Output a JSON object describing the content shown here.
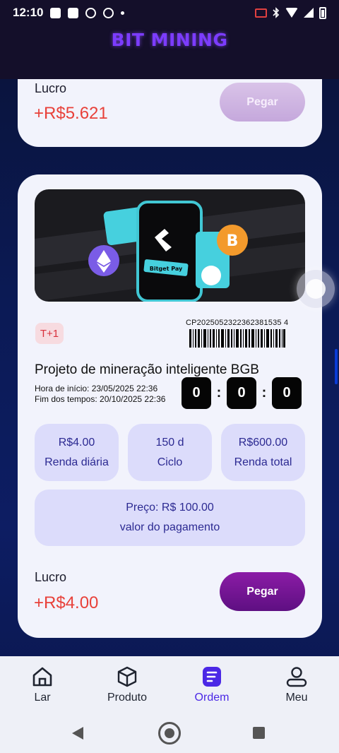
{
  "status_bar": {
    "time": "12:10"
  },
  "header": {
    "brand": "BIT MINING"
  },
  "previous_card": {
    "lucro_label": "Lucro",
    "lucro_value": "+R$5.621",
    "button_label": "Pegar"
  },
  "order": {
    "banner_text": "Bitget Pay",
    "tag": "T+1",
    "code": "CP2025052322362381535 4",
    "title": "Projeto de mineração inteligente BGB",
    "start_time": "Hora de início: 23/05/2025 22:36",
    "end_time": "Fim dos tempos: 20/10/2025 22:36",
    "timer": [
      "0",
      "0",
      "0"
    ],
    "timer_sep": ":",
    "stats": [
      {
        "value": "R$4.00",
        "label": "Renda diária"
      },
      {
        "value": "150 d",
        "label": "Ciclo"
      },
      {
        "value": "R$600.00",
        "label": "Renda total"
      }
    ],
    "price_line": "Preço: R$ 100.00",
    "payment_label": "valor do pagamento",
    "lucro_label": "Lucro",
    "lucro_value": "+R$4.00",
    "button_label": "Pegar"
  },
  "nav": {
    "items": [
      {
        "label": "Lar",
        "icon": "home-icon",
        "active": false
      },
      {
        "label": "Produto",
        "icon": "box-icon",
        "active": false
      },
      {
        "label": "Ordem",
        "icon": "order-icon",
        "active": true
      },
      {
        "label": "Meu",
        "icon": "user-icon",
        "active": false
      }
    ]
  },
  "colors": {
    "accent": "#4b28e6",
    "profit": "#e8413a",
    "button": "#7a1599",
    "stat_bg": "#dcdcfb"
  }
}
